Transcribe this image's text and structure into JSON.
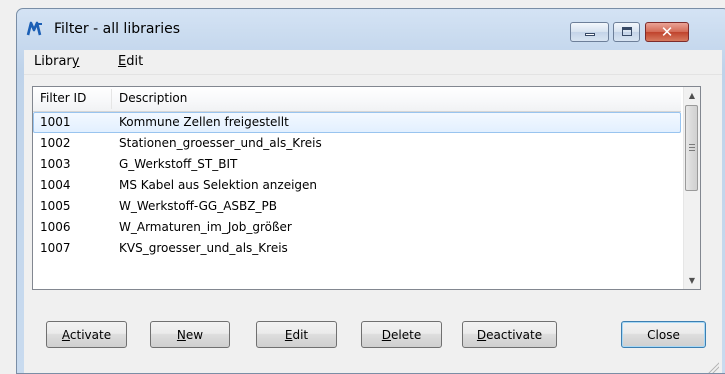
{
  "window": {
    "title": "Filter - all libraries",
    "app_icon": "microstation-icon",
    "controls": {
      "minimize": "minimize-icon",
      "maximize": "maximize-icon",
      "close_glyph": "✕"
    }
  },
  "menu": {
    "items": [
      {
        "mnemonic": "Librar",
        "rest": "y"
      },
      {
        "mnemonic": "E",
        "rest": "dit"
      }
    ]
  },
  "list": {
    "columns": [
      "Filter ID",
      "Description"
    ],
    "rows": [
      {
        "id": "1001",
        "description": "Kommune Zellen freigestellt",
        "selected": true
      },
      {
        "id": "1002",
        "description": "Stationen_groesser_und_als_Kreis"
      },
      {
        "id": "1003",
        "description": "G_Werkstoff_ST_BIT"
      },
      {
        "id": "1004",
        "description": "MS Kabel aus Selektion anzeigen"
      },
      {
        "id": "1005",
        "description": "W_Werkstoff-GG_ASBZ_PB"
      },
      {
        "id": "1006",
        "description": "W_Armaturen_im_Job_größer"
      },
      {
        "id": "1007",
        "description": "KVS_groesser_und_als_Kreis"
      }
    ]
  },
  "buttons": {
    "activate": {
      "mnemonic": "A",
      "rest": "ctivate"
    },
    "new": {
      "mnemonic": "N",
      "rest": "ew"
    },
    "edit": {
      "mnemonic": "E",
      "rest": "dit"
    },
    "delete": {
      "mnemonic": "D",
      "rest": "elete"
    },
    "deactivate": {
      "mnemonic": "D",
      "rest": "eactivate"
    },
    "close": {
      "label": "Close"
    }
  },
  "colors": {
    "titlebar": "#c7d9ee",
    "close_button": "#c0432c",
    "selection": "#e1efff"
  }
}
